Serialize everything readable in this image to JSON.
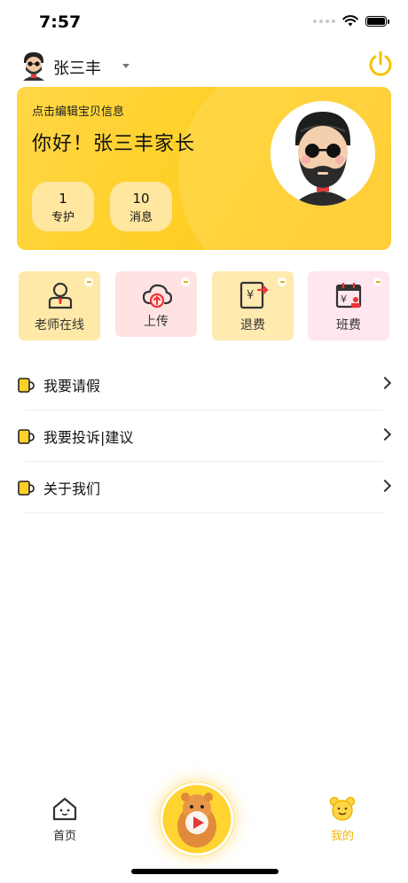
{
  "status": {
    "time": "7:57"
  },
  "header": {
    "user_name": "张三丰"
  },
  "card": {
    "hint": "点击编辑宝贝信息",
    "greeting": "你好！张三丰家长",
    "stats": [
      {
        "value": "1",
        "label": "专护"
      },
      {
        "value": "10",
        "label": "消息"
      }
    ]
  },
  "tiles": [
    {
      "label": "老师在线",
      "icon": "teacher-icon"
    },
    {
      "label": "上传",
      "icon": "upload-cloud-icon"
    },
    {
      "label": "退费",
      "icon": "refund-icon"
    },
    {
      "label": "班费",
      "icon": "class-fee-icon"
    }
  ],
  "menu": [
    {
      "label": "我要请假"
    },
    {
      "label": "我要投诉|建议"
    },
    {
      "label": "关于我们"
    }
  ],
  "tabbar": {
    "home": "首页",
    "me": "我的"
  },
  "colors": {
    "accent": "#FFD028",
    "active_tab": "#F5B400"
  }
}
